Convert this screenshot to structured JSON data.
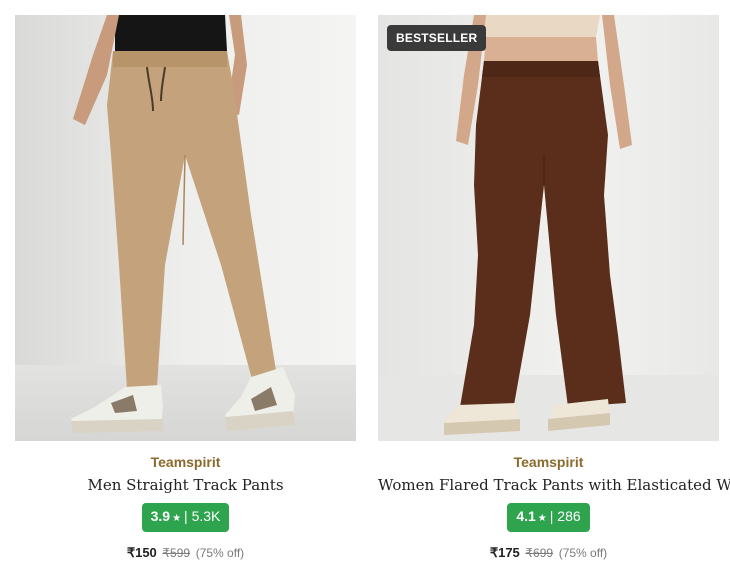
{
  "products": [
    {
      "brand": "Teamspirit",
      "name": "Men Straight Track Pants",
      "rating": "3.9",
      "star": "★",
      "separator": "|",
      "reviews": "5.3K",
      "price": "₹150",
      "mrp": "₹599",
      "discount": "(75% off)",
      "pants_color": "#c4a37c"
    },
    {
      "badge": "BESTSELLER",
      "brand": "Teamspirit",
      "name": "Women Flared Track Pants with Elasticated Waist",
      "rating": "4.1",
      "star": "★",
      "separator": "|",
      "reviews": "286",
      "price": "₹175",
      "mrp": "₹699",
      "discount": "(75% off)",
      "pants_color": "#5a2e1a"
    }
  ],
  "colors": {
    "brand_text": "#8b6a2d",
    "rating_bg": "#2ea44f",
    "badge_bg": "#3a3a3a"
  }
}
